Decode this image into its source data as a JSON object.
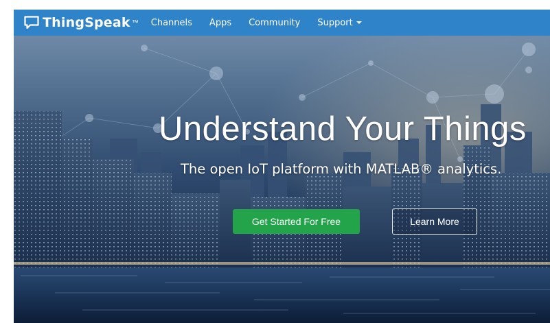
{
  "navbar": {
    "brand": {
      "name": "ThingSpeak",
      "trademark": "™",
      "icon": "chat-bubble-icon"
    },
    "items": [
      {
        "label": "Channels"
      },
      {
        "label": "Apps"
      },
      {
        "label": "Community"
      },
      {
        "label": "Support",
        "has_dropdown": true
      }
    ]
  },
  "hero": {
    "title": "Understand Your Things",
    "subtitle": "The open IoT platform with MATLAB® analytics.",
    "primary_button": "Get Started For Free",
    "secondary_button": "Learn More"
  },
  "colors": {
    "navbar_bg": "#2f83c8",
    "primary_button_bg": "#23a44a",
    "text": "#ffffff"
  }
}
